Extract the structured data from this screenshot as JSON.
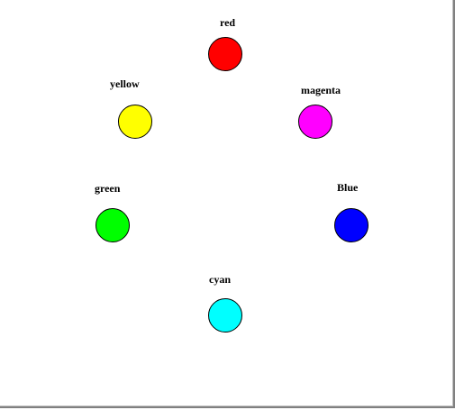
{
  "colors": [
    {
      "key": "red",
      "label": "red",
      "hex": "#ff0000"
    },
    {
      "key": "yellow",
      "label": "yellow",
      "hex": "#ffff00"
    },
    {
      "key": "magenta",
      "label": "magenta",
      "hex": "#ff00ff"
    },
    {
      "key": "green",
      "label": "green",
      "hex": "#00ff00"
    },
    {
      "key": "blue",
      "label": "Blue",
      "hex": "#0000ff"
    },
    {
      "key": "cyan",
      "label": "cyan",
      "hex": "#00ffff"
    }
  ]
}
